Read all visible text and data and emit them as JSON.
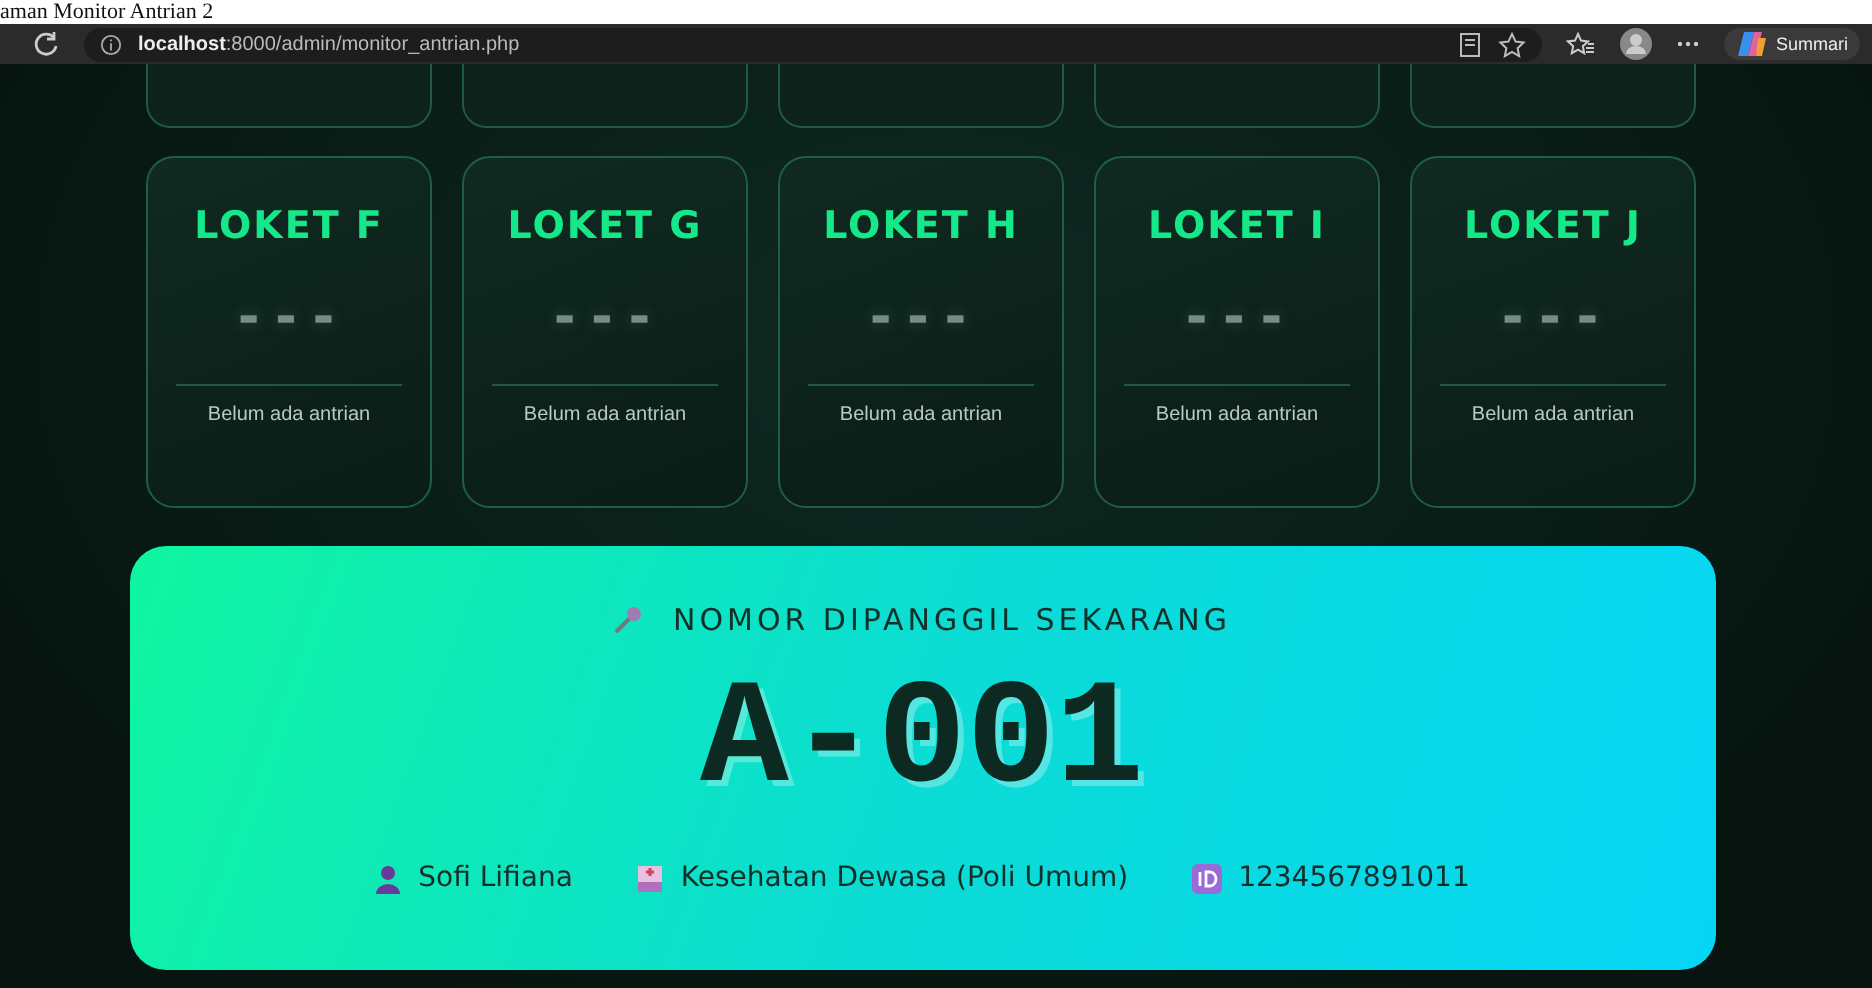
{
  "page_caption": "aman Monitor Antrian 2",
  "browser": {
    "url_host": "localhost",
    "url_path": ":8000/admin/monitor_antrian.php",
    "copilot_label": "Summari"
  },
  "counters": [
    {
      "name": "LOKET F",
      "number": "---",
      "status": "Belum ada antrian"
    },
    {
      "name": "LOKET G",
      "number": "---",
      "status": "Belum ada antrian"
    },
    {
      "name": "LOKET H",
      "number": "---",
      "status": "Belum ada antrian"
    },
    {
      "name": "LOKET I",
      "number": "---",
      "status": "Belum ada antrian"
    },
    {
      "name": "LOKET J",
      "number": "---",
      "status": "Belum ada antrian"
    }
  ],
  "now_calling": {
    "title": "NOMOR DIPANGGIL SEKARANG",
    "number": "A-001",
    "details": [
      {
        "kind": "person",
        "text": "Sofi Lifiana"
      },
      {
        "kind": "clinic",
        "text": "Kesehatan Dewasa (Poli Umum)"
      },
      {
        "kind": "id",
        "text": "1234567891011"
      }
    ]
  }
}
